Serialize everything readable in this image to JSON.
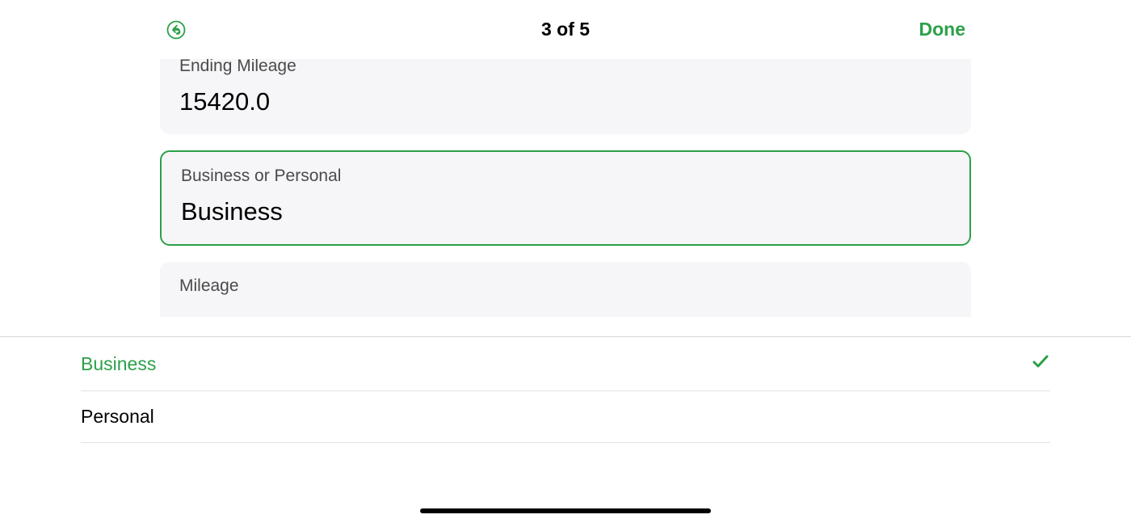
{
  "nav": {
    "title": "3 of 5",
    "done": "Done"
  },
  "fields": {
    "ending_mileage": {
      "label": "Ending Mileage",
      "value": "15420.0"
    },
    "business_personal": {
      "label": "Business or Personal",
      "value": "Business"
    },
    "mileage": {
      "label": "Mileage"
    }
  },
  "picker": {
    "options": [
      {
        "label": "Business",
        "selected": true
      },
      {
        "label": "Personal",
        "selected": false
      }
    ]
  },
  "colors": {
    "accent": "#2ca048",
    "card_bg": "#f6f6f8"
  }
}
